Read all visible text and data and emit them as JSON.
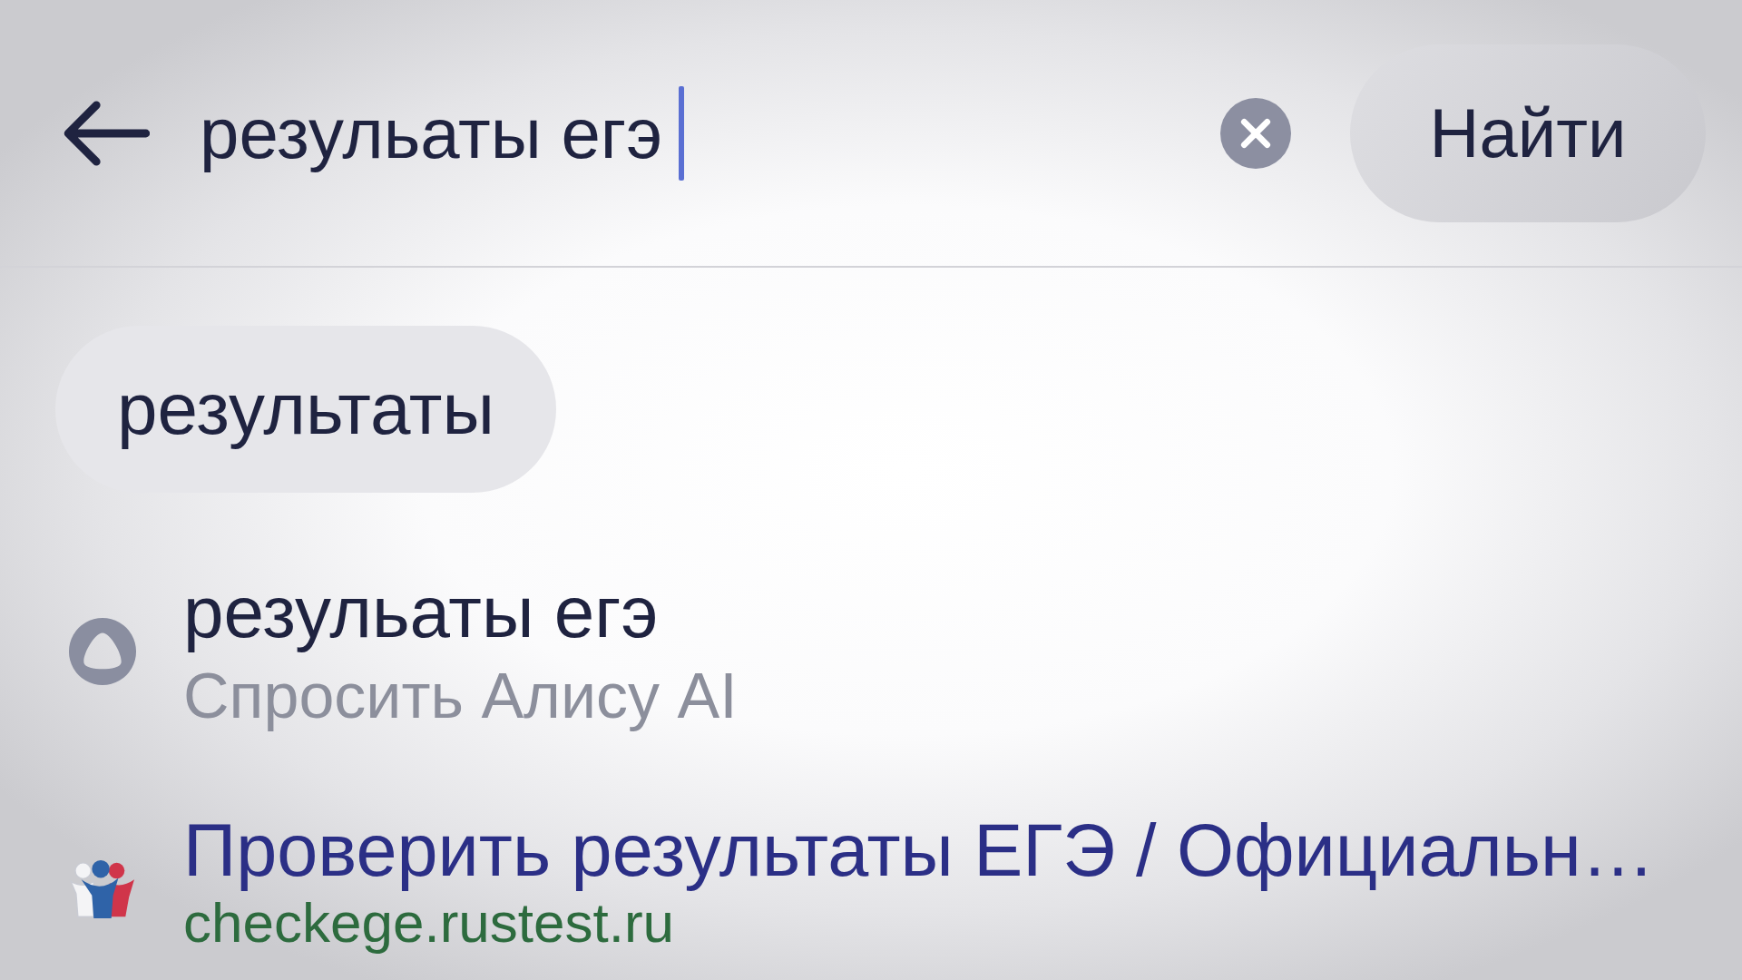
{
  "search": {
    "value": "резульаты егэ",
    "focused": true
  },
  "submit_button": {
    "label": "Найти"
  },
  "chips": [
    {
      "label": "результаты"
    }
  ],
  "suggestions": [
    {
      "kind": "assistant",
      "title": "резульаты егэ",
      "subtitle": "Спросить Алису AI"
    },
    {
      "kind": "site",
      "title": "Проверить результаты ЕГЭ / Официальн…",
      "url": "checkege.rustest.ru"
    }
  ]
}
